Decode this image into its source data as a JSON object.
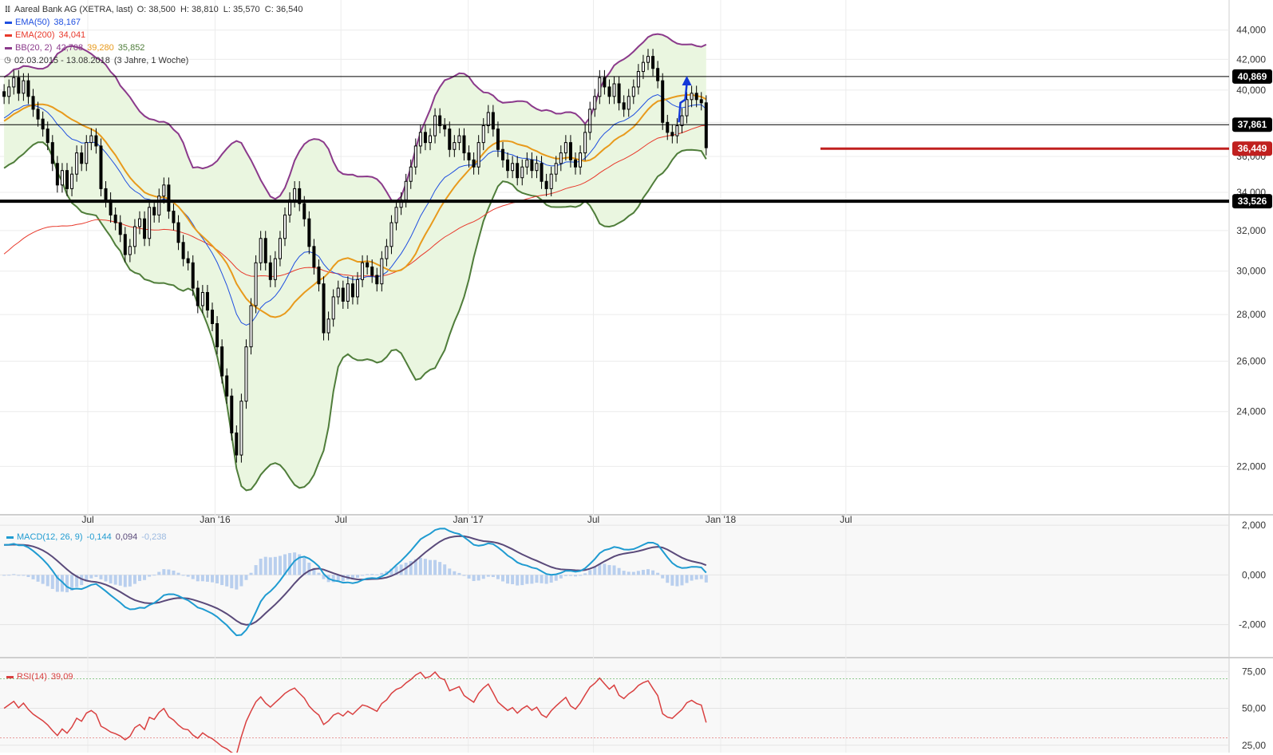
{
  "header": {
    "title": "Aareal Bank AG (XETRA, last)",
    "ohlc": "O: 38,500  H: 38,810  L: 35,570  C: 36,540",
    "ema50_label": "EMA(50)",
    "ema50_value": "38,167",
    "ema200_label": "EMA(200)",
    "ema200_value": "34,041",
    "bb_label": "BB(20, 2)",
    "bb_upper": "42,708",
    "bb_mid": "39,280",
    "bb_lower": "35,852",
    "range": "02.03.2015 - 13.08.2018",
    "range_note": "(3 Jahre, 1 Woche)"
  },
  "colors": {
    "candle": "#000000",
    "ema50": "#1f4fe0",
    "ema200": "#e8392b",
    "bb_upper": "#8b3a8b",
    "bb_lower": "#4f7d3a",
    "bb_mid": "#e89a1c",
    "bb_fill": "#eaf6e0",
    "macd": "#1f9bd1",
    "signal": "#5a4a7a",
    "hist": "#b9cfee",
    "rsi": "#d94040",
    "arrow": "#1438d8",
    "support_red": "#c0201f"
  },
  "macd_legend": {
    "label": "MACD(12, 26, 9)",
    "v1": "-0,144",
    "v2": "0,094",
    "v3": "-0,238"
  },
  "rsi_legend": {
    "label": "RSI(14)",
    "value": "39,09"
  },
  "price_tags": [
    "40,869",
    "37,861",
    "36,449",
    "33,526"
  ],
  "chart_data": {
    "type": "line",
    "title": "Aareal Bank AG (XETRA, last)",
    "x_tick_labels": [
      "Jul",
      "Jan '16",
      "Jul",
      "Jan '17",
      "Jul",
      "Jan '18",
      "Jul"
    ],
    "x_tick_dates": [
      "2015-07-01",
      "2016-01-01",
      "2016-07-01",
      "2017-01-01",
      "2017-07-01",
      "2018-01-01",
      "2018-07-01"
    ],
    "price_axis": {
      "ticks": [
        "22,000",
        "24,000",
        "26,000",
        "28,000",
        "30,000",
        "32,000",
        "34,000",
        "36,000",
        "38,000",
        "40,000",
        "42,000",
        "44,000"
      ],
      "range": [
        20.5,
        45.0
      ],
      "scale": "log"
    },
    "horizontal_levels": [
      {
        "value": 40.869,
        "label": "40,869",
        "color": "#000000"
      },
      {
        "value": 37.861,
        "label": "37,861",
        "color": "#000000"
      },
      {
        "value": 36.449,
        "label": "36,449",
        "color": "#c0201f"
      },
      {
        "value": 33.526,
        "label": "33,526",
        "color": "#000000"
      }
    ],
    "weekly_close": [
      39.6,
      40.2,
      40.8,
      39.8,
      40.6,
      39.6,
      38.8,
      38.2,
      37.6,
      36.8,
      35.6,
      34.4,
      35.2,
      34.2,
      35.0,
      36.2,
      35.6,
      36.8,
      37.2,
      36.6,
      34.2,
      33.6,
      32.8,
      32.4,
      31.8,
      30.8,
      31.2,
      32.2,
      32.6,
      31.6,
      33.2,
      32.8,
      33.8,
      34.4,
      33.0,
      32.4,
      31.4,
      30.6,
      30.4,
      29.2,
      28.4,
      29.0,
      28.2,
      27.6,
      26.6,
      25.4,
      24.6,
      23.2,
      22.4,
      24.4,
      26.6,
      28.4,
      30.4,
      31.6,
      30.4,
      29.6,
      30.6,
      31.6,
      32.8,
      33.6,
      34.2,
      33.4,
      32.6,
      31.2,
      30.2,
      29.4,
      27.2,
      27.8,
      28.8,
      29.2,
      28.6,
      29.4,
      28.8,
      29.6,
      30.4,
      30.2,
      29.8,
      29.4,
      30.6,
      31.2,
      32.4,
      33.2,
      33.6,
      34.6,
      35.4,
      36.6,
      37.4,
      36.8,
      37.2,
      38.4,
      37.8,
      37.6,
      36.4,
      36.8,
      37.2,
      36.2,
      35.8,
      35.4,
      36.8,
      37.8,
      38.6,
      37.6,
      36.4,
      35.8,
      35.2,
      35.6,
      34.8,
      35.4,
      35.8,
      35.2,
      35.6,
      34.6,
      34.2,
      35.0,
      35.6,
      36.2,
      36.8,
      35.8,
      35.4,
      36.2,
      37.4,
      38.8,
      39.6,
      40.8,
      40.2,
      39.6,
      40.4,
      39.2,
      38.8,
      39.6,
      40.2,
      41.2,
      41.8,
      42.2,
      41.4,
      40.6,
      38.0,
      37.4,
      37.2,
      37.8,
      38.4,
      39.4,
      39.8,
      39.4,
      39.2,
      36.5
    ],
    "weekly_start": "2015-03-02",
    "rsi_axis": {
      "ticks": [
        "25,00",
        "50,00",
        "75,00"
      ],
      "range": [
        20,
        80
      ],
      "overbought": 70,
      "oversold": 30
    },
    "macd_axis": {
      "ticks": [
        "-2,000",
        "0,000",
        "2,000"
      ],
      "range": [
        -3.2,
        2.1
      ]
    },
    "series": [
      {
        "name": "EMA(50)",
        "last": 38.167
      },
      {
        "name": "EMA(200)",
        "last": 34.041
      },
      {
        "name": "BB(20, 2)",
        "upper": 42.708,
        "mid": 39.28,
        "lower": 35.852
      },
      {
        "name": "MACD(12, 26, 9)",
        "macd": -0.144,
        "signal": 0.094,
        "histogram": -0.238
      },
      {
        "name": "RSI(14)",
        "last": 39.09
      }
    ],
    "grid": true,
    "legend_placement": "top-left"
  }
}
